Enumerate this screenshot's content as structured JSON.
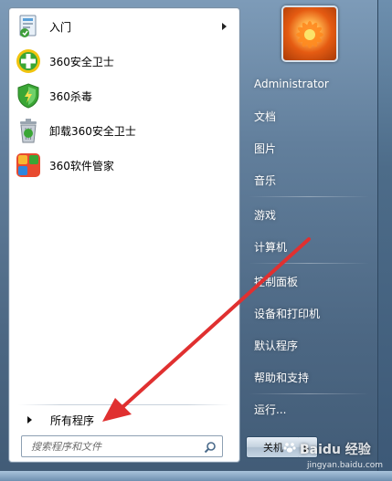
{
  "left_pane": {
    "items": [
      {
        "label": "入门",
        "icon": "getting-started-icon",
        "has_submenu": true
      },
      {
        "label": "360安全卫士",
        "icon": "360-safeguard-icon",
        "has_submenu": false
      },
      {
        "label": "360杀毒",
        "icon": "360-antivirus-icon",
        "has_submenu": false
      },
      {
        "label": "卸载360安全卫士",
        "icon": "uninstall-360-icon",
        "has_submenu": false
      },
      {
        "label": "360软件管家",
        "icon": "360-software-manager-icon",
        "has_submenu": false
      }
    ],
    "all_programs_label": "所有程序",
    "search_placeholder": "搜索程序和文件"
  },
  "right_pane": {
    "user_name": "Administrator",
    "items": [
      {
        "label": "文档"
      },
      {
        "label": "图片"
      },
      {
        "label": "音乐"
      },
      {
        "label": "游戏"
      },
      {
        "label": "计算机"
      },
      {
        "label": "控制面板"
      },
      {
        "label": "设备和打印机"
      },
      {
        "label": "默认程序"
      },
      {
        "label": "帮助和支持"
      },
      {
        "label": "运行..."
      }
    ],
    "shutdown_label": "关机"
  },
  "watermark": {
    "brand": "Baidu 经验",
    "url": "jingyan.baidu.com"
  },
  "colors": {
    "annotation_arrow": "#e03030",
    "menu_blue": "#4c6783"
  }
}
